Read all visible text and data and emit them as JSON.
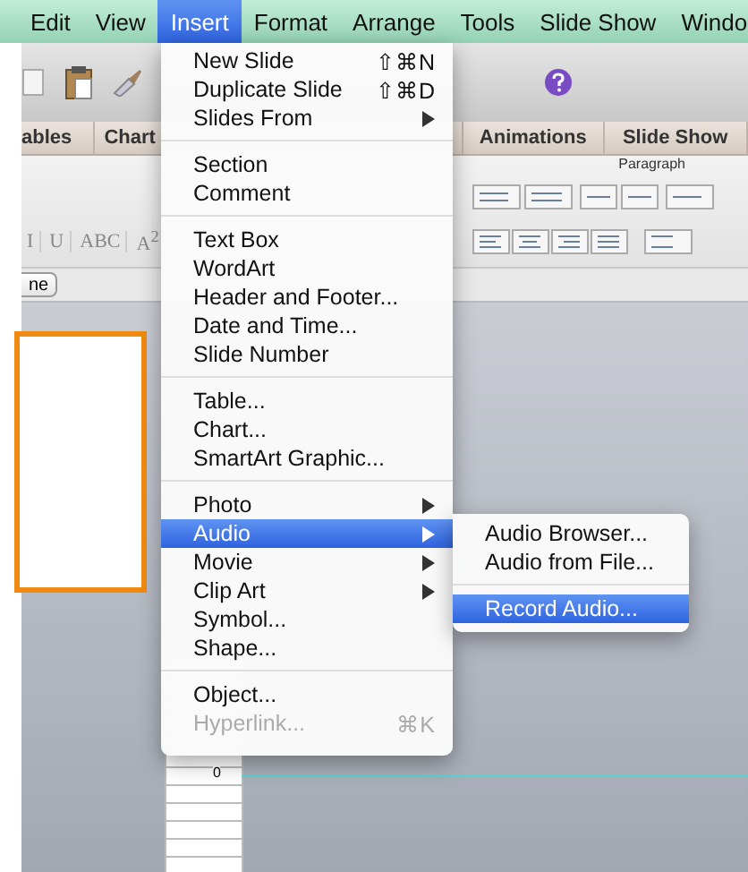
{
  "menu_bar": [
    {
      "label": "Edit",
      "selected": false
    },
    {
      "label": "View",
      "selected": false
    },
    {
      "label": "Insert",
      "selected": true
    },
    {
      "label": "Format",
      "selected": false
    },
    {
      "label": "Arrange",
      "selected": false
    },
    {
      "label": "Tools",
      "selected": false
    },
    {
      "label": "Slide Show",
      "selected": false
    },
    {
      "label": "Windo",
      "selected": false
    }
  ],
  "ribbon_tabs": [
    "ables",
    "Chart",
    "Animations",
    "Slide Show"
  ],
  "paragraph_group": "Paragraph",
  "format_buttons": [
    "I",
    "U",
    "ABC",
    "A$^{2}$"
  ],
  "small_button": "ne",
  "ruler_label": "0",
  "insert_menu": [
    {
      "kind": "item",
      "label": "New Slide",
      "shortcut": "⇧⌘N",
      "submenu": false,
      "selected": false,
      "disabled": false
    },
    {
      "kind": "item",
      "label": "Duplicate Slide",
      "shortcut": "⇧⌘D",
      "submenu": false,
      "selected": false,
      "disabled": false
    },
    {
      "kind": "item",
      "label": "Slides From",
      "submenu": true,
      "selected": false,
      "disabled": false
    },
    {
      "kind": "separator"
    },
    {
      "kind": "item",
      "label": "Section",
      "submenu": false,
      "selected": false,
      "disabled": false
    },
    {
      "kind": "item",
      "label": "Comment",
      "submenu": false,
      "selected": false,
      "disabled": false
    },
    {
      "kind": "separator"
    },
    {
      "kind": "item",
      "label": "Text Box",
      "submenu": false,
      "selected": false,
      "disabled": false
    },
    {
      "kind": "item",
      "label": "WordArt",
      "submenu": false,
      "selected": false,
      "disabled": false
    },
    {
      "kind": "item",
      "label": "Header and Footer...",
      "submenu": false,
      "selected": false,
      "disabled": false
    },
    {
      "kind": "item",
      "label": "Date and Time...",
      "submenu": false,
      "selected": false,
      "disabled": false
    },
    {
      "kind": "item",
      "label": "Slide Number",
      "submenu": false,
      "selected": false,
      "disabled": false
    },
    {
      "kind": "separator"
    },
    {
      "kind": "item",
      "label": "Table...",
      "submenu": false,
      "selected": false,
      "disabled": false
    },
    {
      "kind": "item",
      "label": "Chart...",
      "submenu": false,
      "selected": false,
      "disabled": false
    },
    {
      "kind": "item",
      "label": "SmartArt Graphic...",
      "submenu": false,
      "selected": false,
      "disabled": false
    },
    {
      "kind": "separator"
    },
    {
      "kind": "item",
      "label": "Photo",
      "submenu": true,
      "selected": false,
      "disabled": false
    },
    {
      "kind": "item",
      "label": "Audio",
      "submenu": true,
      "selected": true,
      "disabled": false
    },
    {
      "kind": "item",
      "label": "Movie",
      "submenu": true,
      "selected": false,
      "disabled": false
    },
    {
      "kind": "item",
      "label": "Clip Art",
      "submenu": true,
      "selected": false,
      "disabled": false
    },
    {
      "kind": "item",
      "label": "Symbol...",
      "submenu": false,
      "selected": false,
      "disabled": false
    },
    {
      "kind": "item",
      "label": "Shape...",
      "submenu": false,
      "selected": false,
      "disabled": false
    },
    {
      "kind": "separator"
    },
    {
      "kind": "item",
      "label": "Object...",
      "submenu": false,
      "selected": false,
      "disabled": false
    },
    {
      "kind": "item",
      "label": "Hyperlink...",
      "shortcut": "⌘K",
      "submenu": false,
      "selected": false,
      "disabled": true
    }
  ],
  "audio_submenu": [
    {
      "kind": "item",
      "label": "Audio Browser...",
      "selected": false
    },
    {
      "kind": "item",
      "label": "Audio from File...",
      "selected": false
    },
    {
      "kind": "separator"
    },
    {
      "kind": "item",
      "label": "Record Audio...",
      "selected": true
    }
  ]
}
